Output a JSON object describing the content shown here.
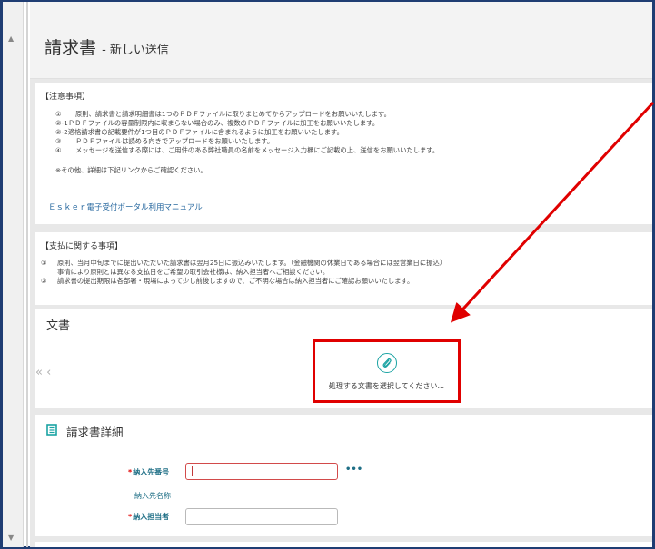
{
  "page": {
    "title": "請求書",
    "title_sub": "- 新しい送信"
  },
  "notice": {
    "heading": "【注意事項】",
    "items": [
      {
        "num": "①",
        "text": "原則、請求書と請求明細書は1つのＰＤＦファイルに取りまとめてからアップロードをお願いいたします。"
      },
      {
        "num": "②-1",
        "text": "ＰＤＦファイルの容量制限内に収まらない場合のみ、複数のＰＤＦファイルに加工をお願いいたします。"
      },
      {
        "num": "②-2",
        "text": "適格請求書の記載要件が1つ目のＰＤＦファイルに含まれるように加工をお願いいたします。"
      },
      {
        "num": "③",
        "text": "ＰＤＦファイルは読める向きでアップロードをお願いいたします。"
      },
      {
        "num": "④",
        "text": "メッセージを送信する際には、ご用件のある弊社職員の名前をメッセージ入力欄にご記載の上、送信をお願いいたします。"
      }
    ],
    "footer": "※その他、詳細は下記リンクからご確認ください。",
    "link": "Ｅｓｋｅｒ電子受付ポータル利用マニュアル"
  },
  "payment": {
    "heading": "【支払に関する事項】",
    "line1_num": "①",
    "line1": "原則、当月中旬までに提出いただいた請求書は翌月25日に振込みいたします。（金融機関の休業日である場合には翌営業日に振込）",
    "line1b": "事情により原則とは異なる支払日をご希望の取引会社様は、納入担当者へご相談ください。",
    "line2_num": "②",
    "line2": "請求書の提出期限は各部署・現場によって少し前後しますので、ご不明な場合は納入担当者にご確認お願いいたします。"
  },
  "documents": {
    "title": "文書",
    "nav": "« ‹",
    "select_text": "処理する文書を選択してください..."
  },
  "details": {
    "title": "請求書詳細",
    "required_mark": "*",
    "field1_label": "納入先番号",
    "field1_value": "",
    "more": "•••",
    "field2_label": "納入先名称",
    "field3_label": "納入担当者",
    "field3_value": ""
  },
  "colors": {
    "frame": "#1f3d73",
    "annotation": "#e00000",
    "label": "#1f6f86",
    "link": "#2a6aa0",
    "icon": "#1aa3a3"
  }
}
